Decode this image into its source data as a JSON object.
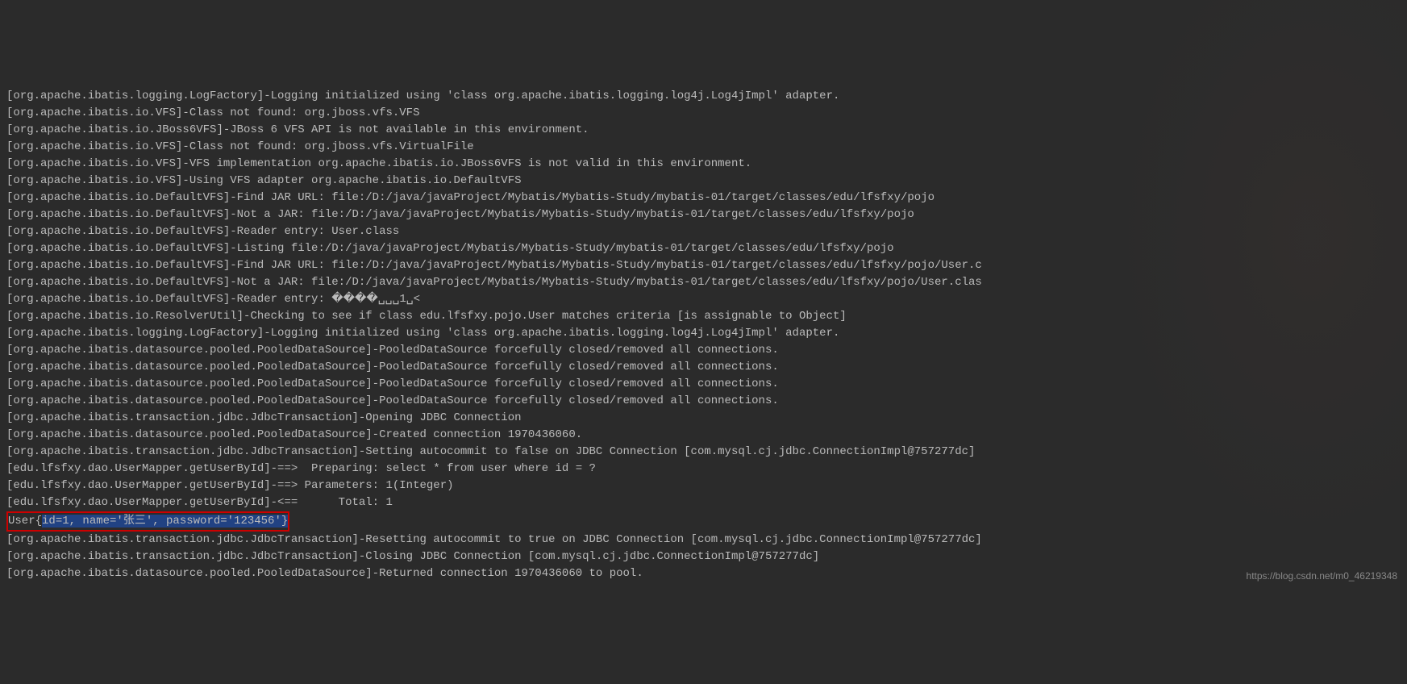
{
  "lines": [
    "[org.apache.ibatis.logging.LogFactory]-Logging initialized using 'class org.apache.ibatis.logging.log4j.Log4jImpl' adapter.",
    "[org.apache.ibatis.io.VFS]-Class not found: org.jboss.vfs.VFS",
    "[org.apache.ibatis.io.JBoss6VFS]-JBoss 6 VFS API is not available in this environment.",
    "[org.apache.ibatis.io.VFS]-Class not found: org.jboss.vfs.VirtualFile",
    "[org.apache.ibatis.io.VFS]-VFS implementation org.apache.ibatis.io.JBoss6VFS is not valid in this environment.",
    "[org.apache.ibatis.io.VFS]-Using VFS adapter org.apache.ibatis.io.DefaultVFS",
    "[org.apache.ibatis.io.DefaultVFS]-Find JAR URL: file:/D:/java/javaProject/Mybatis/Mybatis-Study/mybatis-01/target/classes/edu/lfsfxy/pojo",
    "[org.apache.ibatis.io.DefaultVFS]-Not a JAR: file:/D:/java/javaProject/Mybatis/Mybatis-Study/mybatis-01/target/classes/edu/lfsfxy/pojo",
    "[org.apache.ibatis.io.DefaultVFS]-Reader entry: User.class",
    "[org.apache.ibatis.io.DefaultVFS]-Listing file:/D:/java/javaProject/Mybatis/Mybatis-Study/mybatis-01/target/classes/edu/lfsfxy/pojo",
    "[org.apache.ibatis.io.DefaultVFS]-Find JAR URL: file:/D:/java/javaProject/Mybatis/Mybatis-Study/mybatis-01/target/classes/edu/lfsfxy/pojo/User.c",
    "[org.apache.ibatis.io.DefaultVFS]-Not a JAR: file:/D:/java/javaProject/Mybatis/Mybatis-Study/mybatis-01/target/classes/edu/lfsfxy/pojo/User.clas",
    "[org.apache.ibatis.io.DefaultVFS]-Reader entry: ����␣␣␣1␣<",
    "[org.apache.ibatis.io.ResolverUtil]-Checking to see if class edu.lfsfxy.pojo.User matches criteria [is assignable to Object]",
    "[org.apache.ibatis.logging.LogFactory]-Logging initialized using 'class org.apache.ibatis.logging.log4j.Log4jImpl' adapter.",
    "[org.apache.ibatis.datasource.pooled.PooledDataSource]-PooledDataSource forcefully closed/removed all connections.",
    "[org.apache.ibatis.datasource.pooled.PooledDataSource]-PooledDataSource forcefully closed/removed all connections.",
    "[org.apache.ibatis.datasource.pooled.PooledDataSource]-PooledDataSource forcefully closed/removed all connections.",
    "[org.apache.ibatis.datasource.pooled.PooledDataSource]-PooledDataSource forcefully closed/removed all connections.",
    "[org.apache.ibatis.transaction.jdbc.JdbcTransaction]-Opening JDBC Connection",
    "[org.apache.ibatis.datasource.pooled.PooledDataSource]-Created connection 1970436060.",
    "[org.apache.ibatis.transaction.jdbc.JdbcTransaction]-Setting autocommit to false on JDBC Connection [com.mysql.cj.jdbc.ConnectionImpl@757277dc]",
    "[edu.lfsfxy.dao.UserMapper.getUserById]-==>  Preparing: select * from user where id = ?",
    "[edu.lfsfxy.dao.UserMapper.getUserById]-==> Parameters: 1(Integer)",
    "[edu.lfsfxy.dao.UserMapper.getUserById]-<==      Total: 1"
  ],
  "highlighted_line": {
    "prefix": "User{",
    "selected": "id=1, name='张三', password='123456'}",
    "suffix": ""
  },
  "lines_after": [
    "[org.apache.ibatis.transaction.jdbc.JdbcTransaction]-Resetting autocommit to true on JDBC Connection [com.mysql.cj.jdbc.ConnectionImpl@757277dc]",
    "[org.apache.ibatis.transaction.jdbc.JdbcTransaction]-Closing JDBC Connection [com.mysql.cj.jdbc.ConnectionImpl@757277dc]",
    "[org.apache.ibatis.datasource.pooled.PooledDataSource]-Returned connection 1970436060 to pool."
  ],
  "watermark": "https://blog.csdn.net/m0_46219348"
}
